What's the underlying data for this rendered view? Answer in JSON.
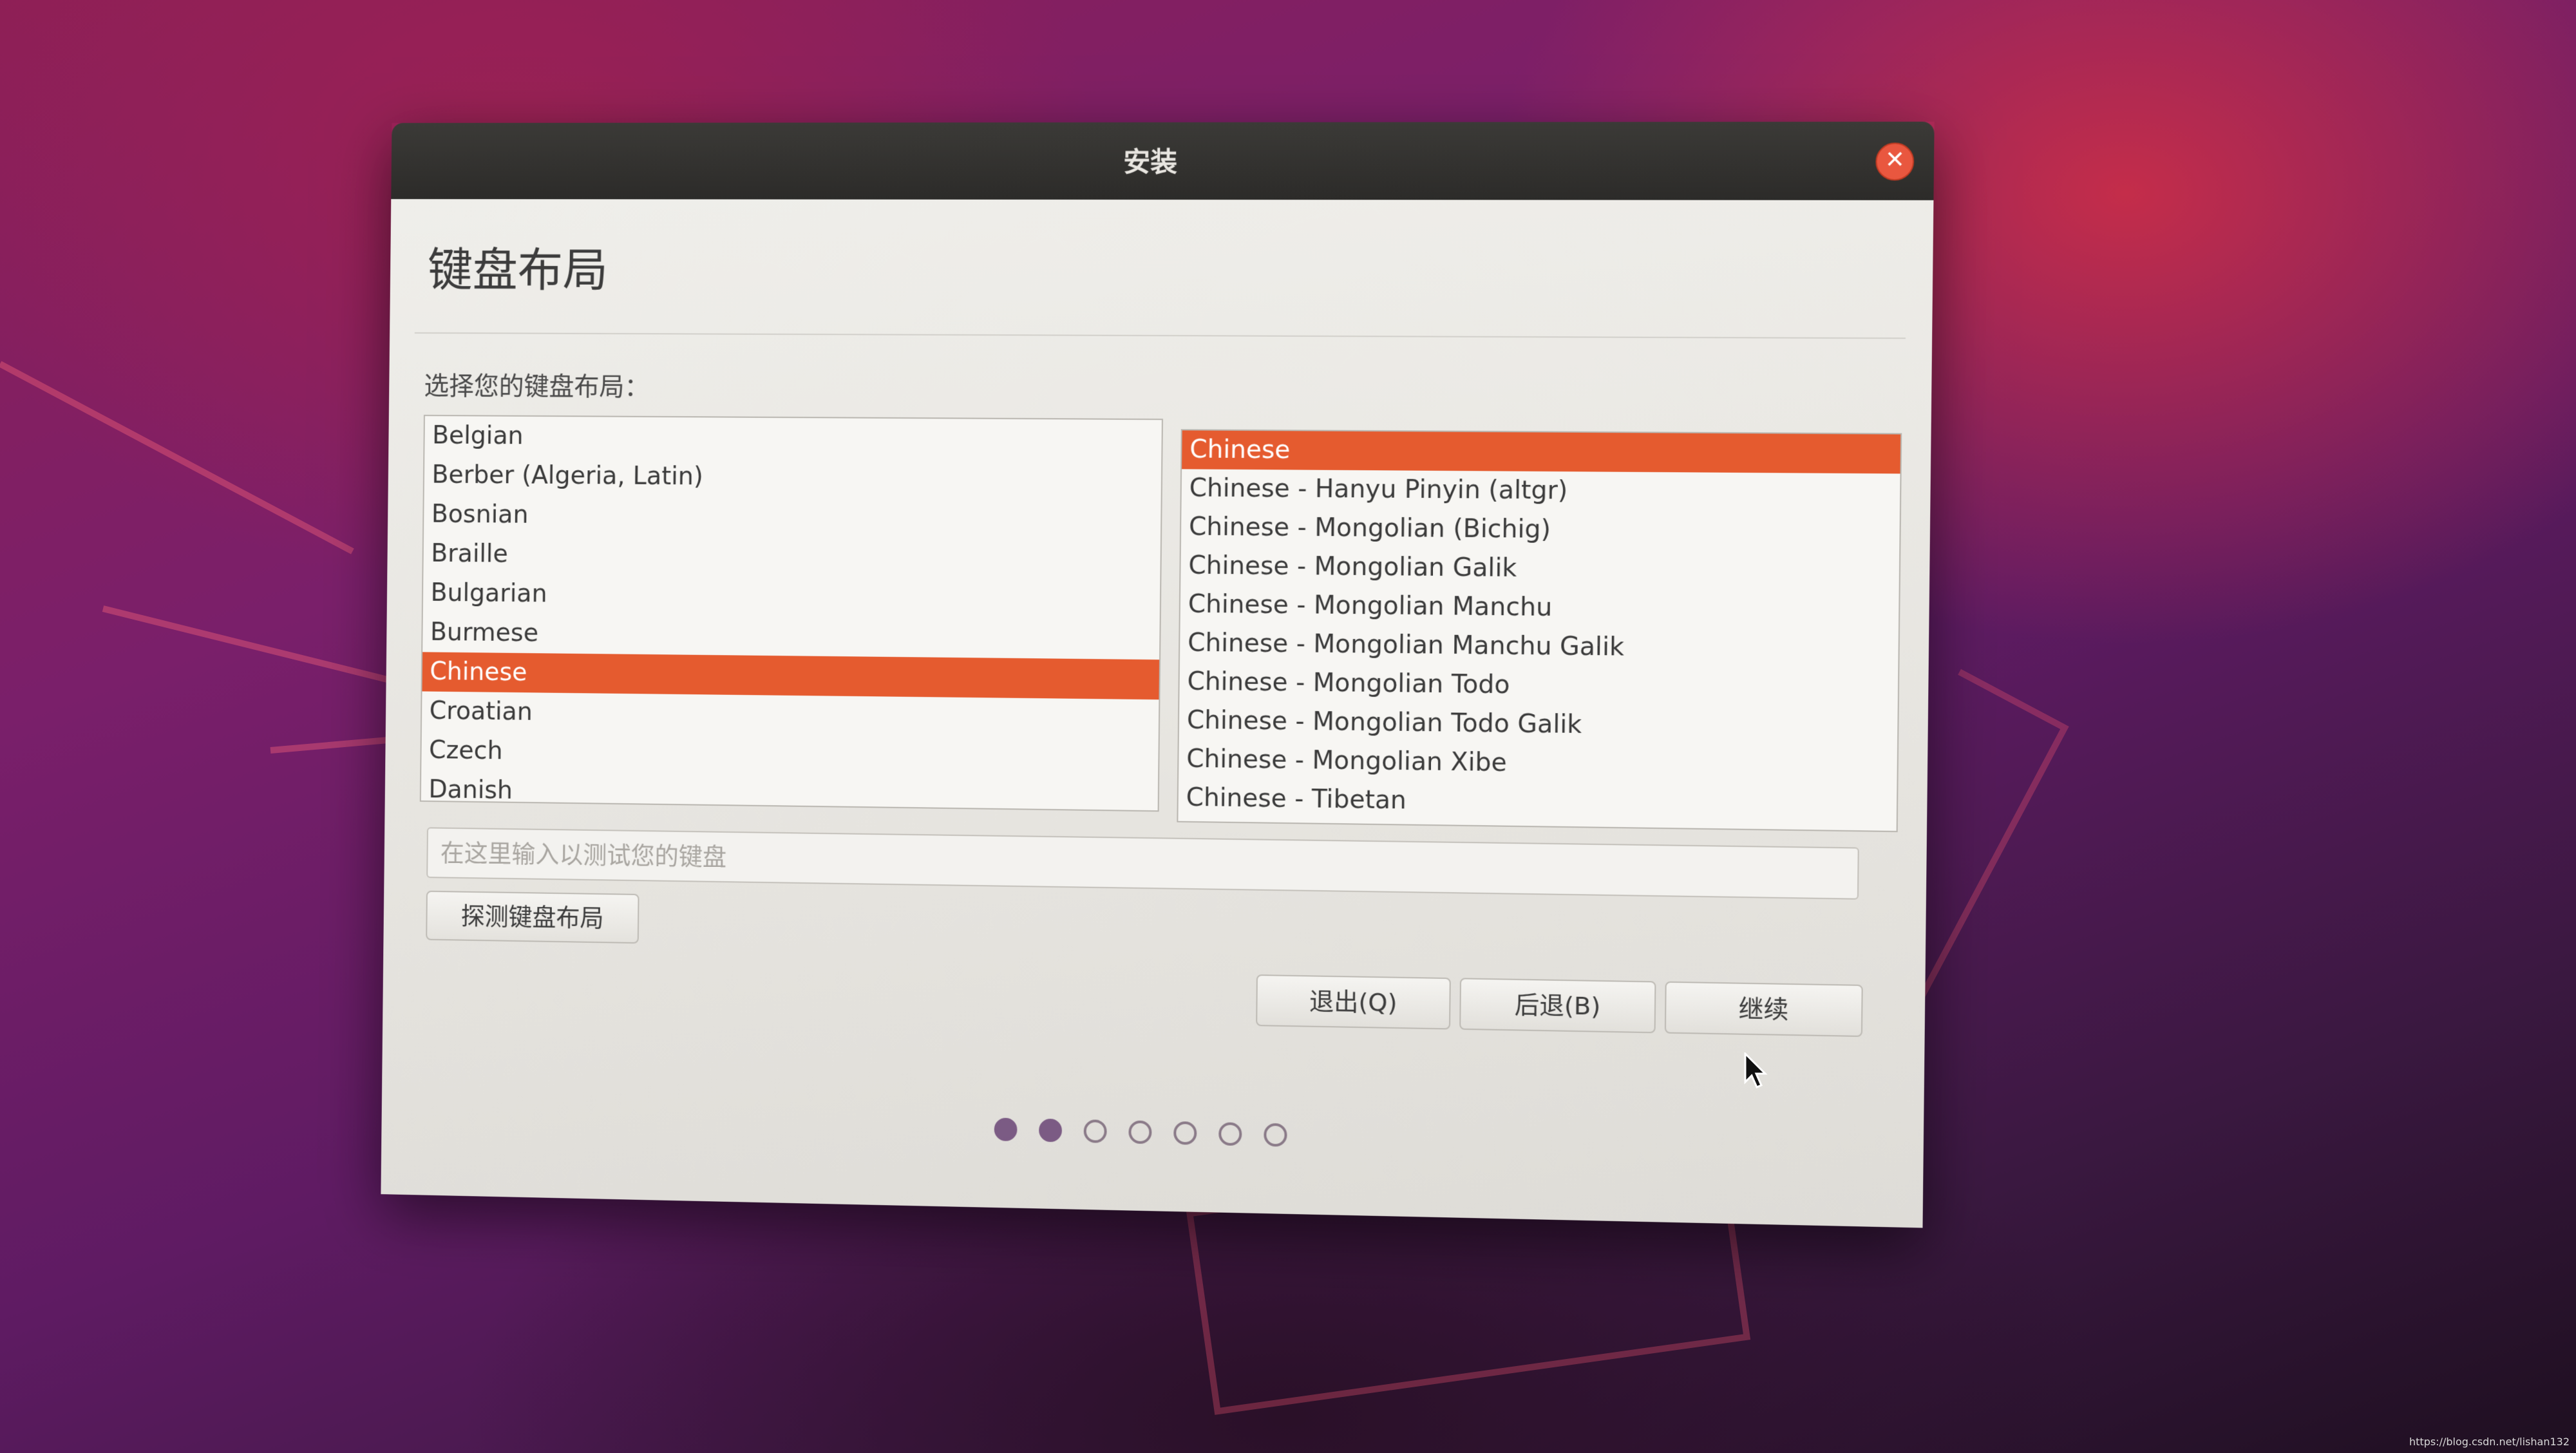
{
  "window": {
    "title": "安装",
    "close_icon": "close-icon"
  },
  "page": {
    "title": "键盘布局",
    "prompt": "选择您的键盘布局："
  },
  "layouts": {
    "items": [
      {
        "label": "Belgian",
        "selected": false
      },
      {
        "label": "Berber (Algeria, Latin)",
        "selected": false
      },
      {
        "label": "Bosnian",
        "selected": false
      },
      {
        "label": "Braille",
        "selected": false
      },
      {
        "label": "Bulgarian",
        "selected": false
      },
      {
        "label": "Burmese",
        "selected": false
      },
      {
        "label": "Chinese",
        "selected": true
      },
      {
        "label": "Croatian",
        "selected": false
      },
      {
        "label": "Czech",
        "selected": false
      },
      {
        "label": "Danish",
        "selected": false
      }
    ]
  },
  "variants": {
    "items": [
      {
        "label": "Chinese",
        "selected": true
      },
      {
        "label": "Chinese - Hanyu Pinyin (altgr)",
        "selected": false
      },
      {
        "label": "Chinese - Mongolian (Bichig)",
        "selected": false
      },
      {
        "label": "Chinese - Mongolian Galik",
        "selected": false
      },
      {
        "label": "Chinese - Mongolian Manchu",
        "selected": false
      },
      {
        "label": "Chinese - Mongolian Manchu Galik",
        "selected": false
      },
      {
        "label": "Chinese - Mongolian Todo",
        "selected": false
      },
      {
        "label": "Chinese - Mongolian Todo Galik",
        "selected": false
      },
      {
        "label": "Chinese - Mongolian Xibe",
        "selected": false
      },
      {
        "label": "Chinese - Tibetan",
        "selected": false
      }
    ]
  },
  "test_input": {
    "value": "",
    "placeholder": "在这里输入以测试您的键盘"
  },
  "buttons": {
    "detect": "探测键盘布局",
    "quit": "退出(Q)",
    "back": "后退(B)",
    "continue": "继续"
  },
  "progress": {
    "total_steps": 7,
    "completed_steps": 2
  },
  "colors": {
    "selection": "#e55b2f",
    "close_button": "#e9573f",
    "progress_dot": "#7b5b84"
  },
  "watermark": "https://blog.csdn.net/lishan132"
}
